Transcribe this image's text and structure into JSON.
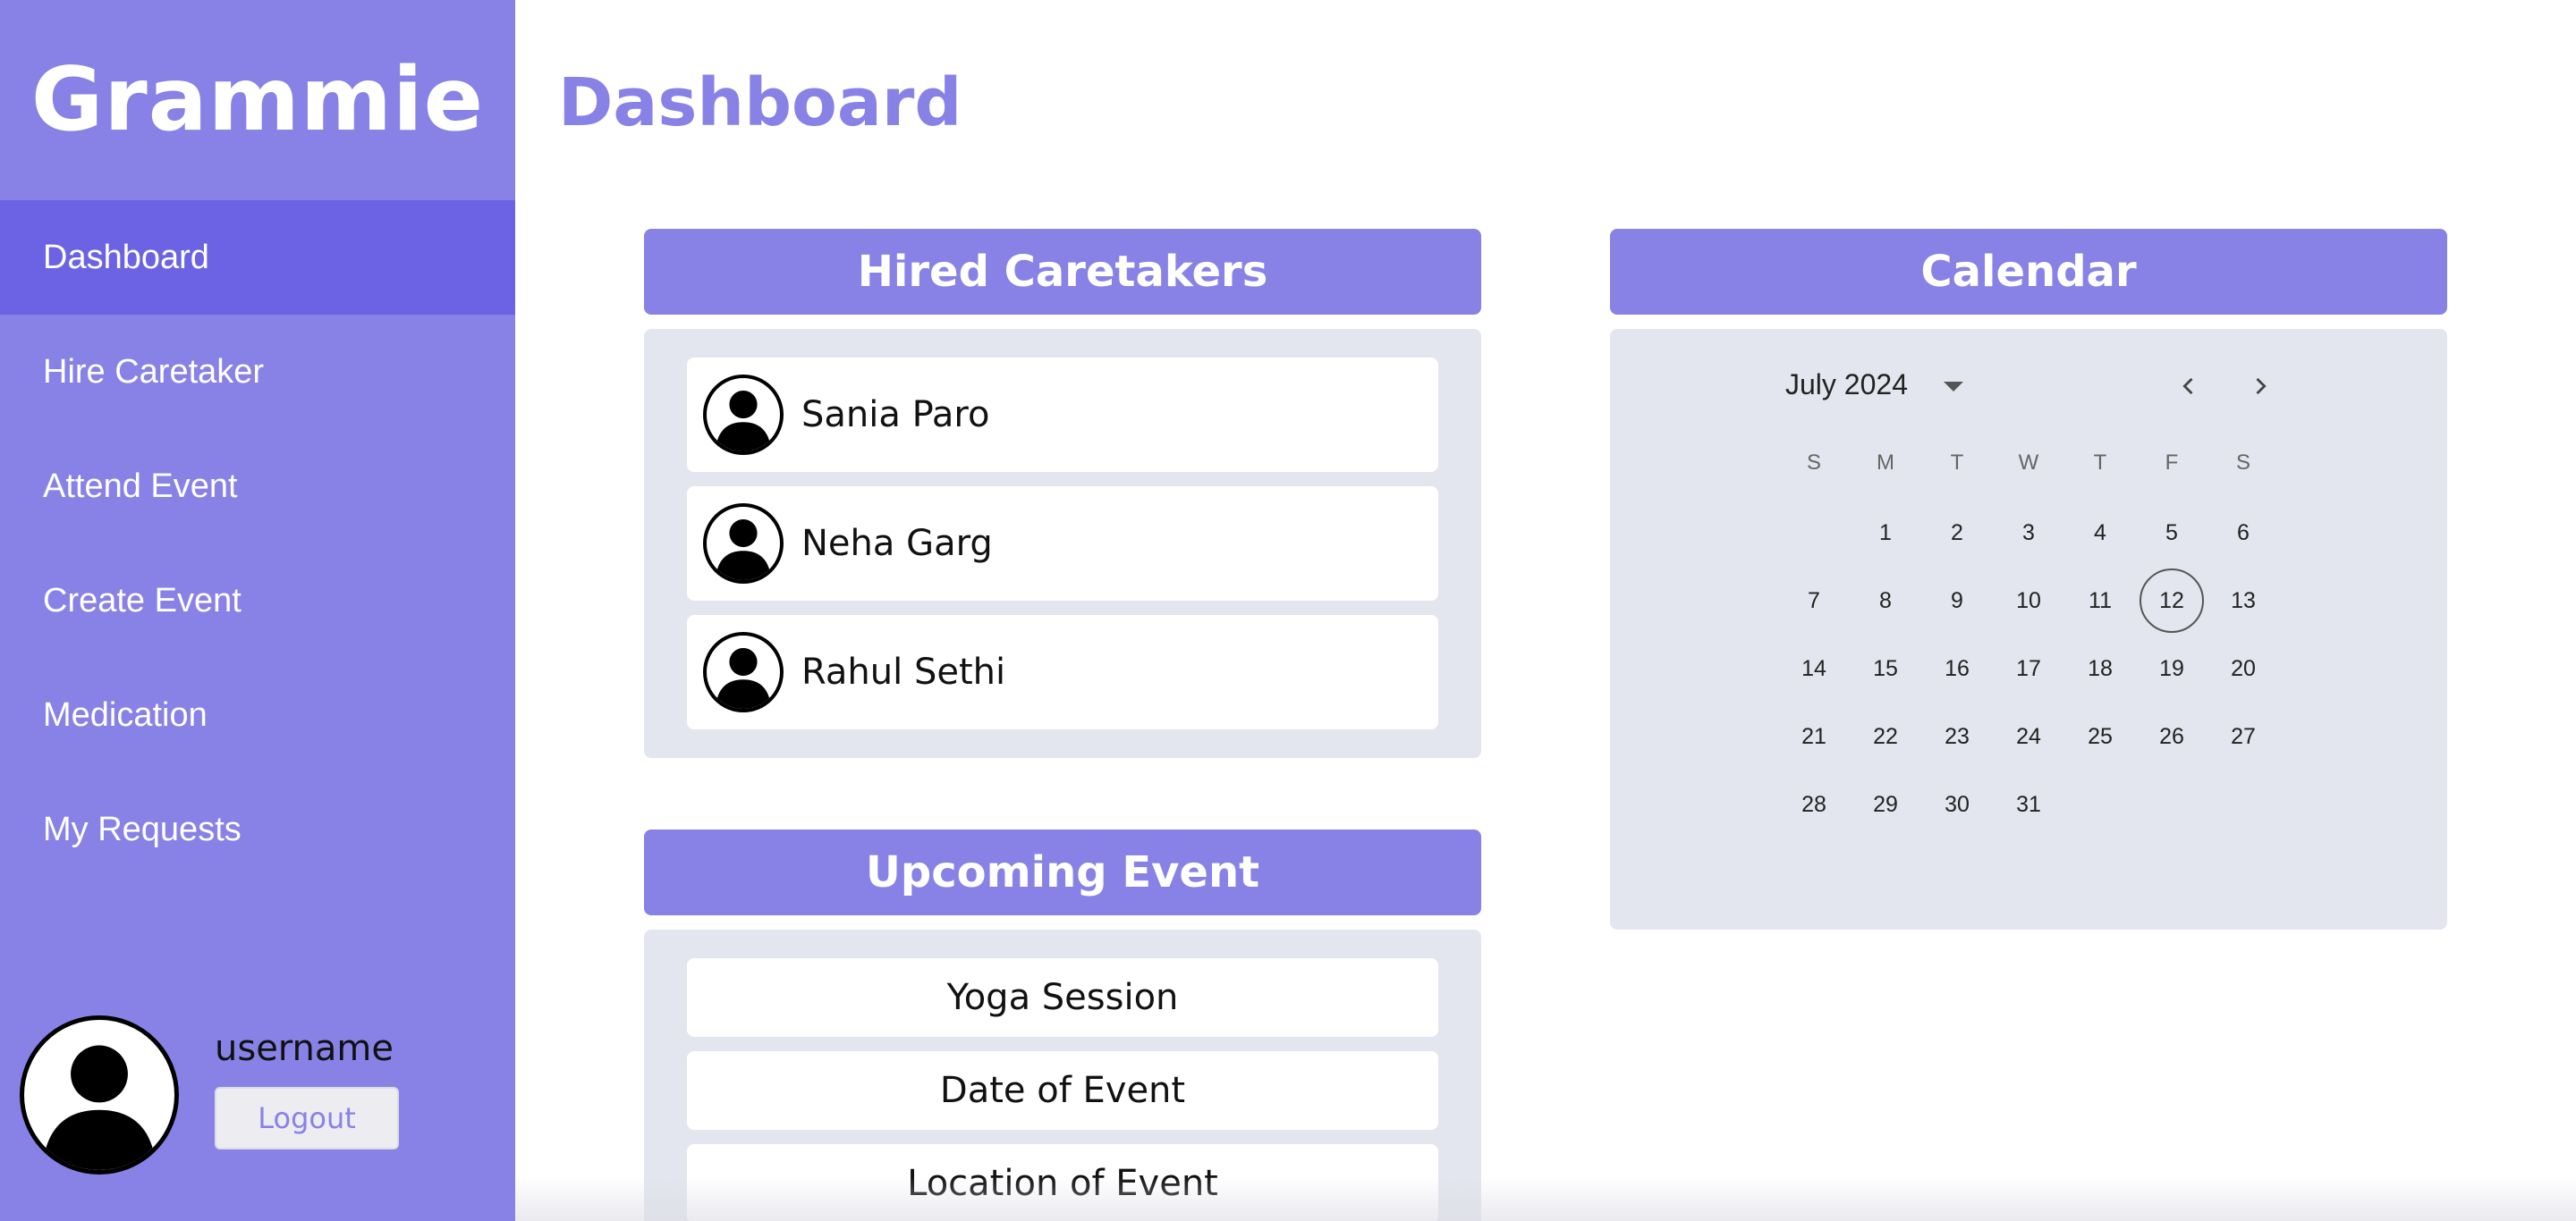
{
  "app": {
    "brand": "Grammie"
  },
  "sidebar": {
    "items": [
      {
        "label": "Dashboard",
        "active": true
      },
      {
        "label": "Hire Caretaker"
      },
      {
        "label": "Attend Event"
      },
      {
        "label": "Create Event"
      },
      {
        "label": "Medication"
      },
      {
        "label": "My Requests"
      }
    ],
    "user": {
      "name": "username",
      "logout_label": "Logout",
      "avatar_icon": "user-silhouette-icon"
    }
  },
  "main": {
    "title": "Dashboard",
    "hired_caretakers": {
      "title": "Hired Caretakers",
      "people": [
        {
          "name": "Sania Paro",
          "avatar_icon": "user-silhouette-icon"
        },
        {
          "name": "Neha Garg",
          "avatar_icon": "user-silhouette-icon"
        },
        {
          "name": "Rahul Sethi",
          "avatar_icon": "user-silhouette-icon"
        }
      ]
    },
    "upcoming_event": {
      "title": "Upcoming Event",
      "rows": [
        "Yoga Session",
        "Date of Event",
        "Location of Event"
      ]
    },
    "calendar": {
      "title": "Calendar",
      "month_label": "July 2024",
      "weekdays": [
        "S",
        "M",
        "T",
        "W",
        "T",
        "F",
        "S"
      ],
      "first_weekday_index": 1,
      "days_in_month": 31,
      "today": 12,
      "icons": {
        "dropdown": "caret-down-icon",
        "prev": "chevron-left-icon",
        "next": "chevron-right-icon"
      }
    }
  },
  "colors": {
    "brand": "#8882e6",
    "sidebar_active": "#6b63e3",
    "panel_body": "#e3e6ee"
  }
}
